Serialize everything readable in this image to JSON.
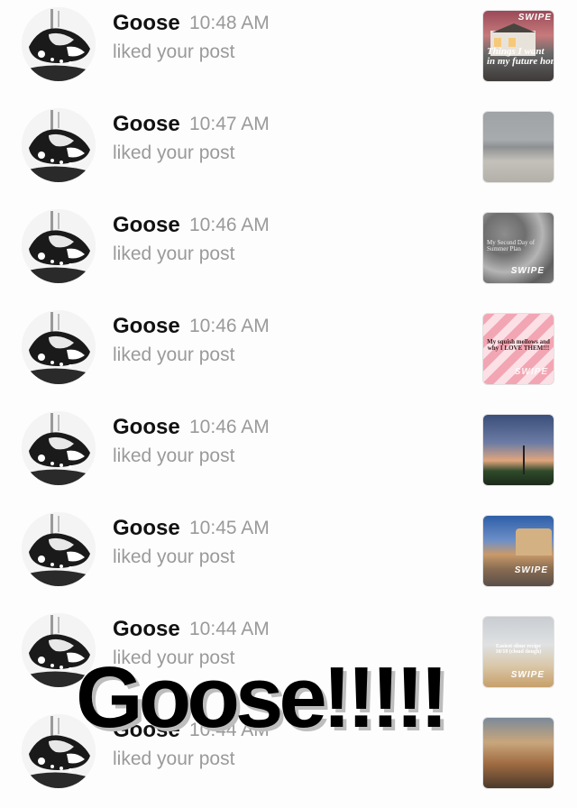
{
  "notifications": [
    {
      "user": "Goose",
      "time": "10:48 AM",
      "action": "liked your post",
      "thumb_caption": "Things I want\nin my future home",
      "thumb_tag": "SWIPE"
    },
    {
      "user": "Goose",
      "time": "10:47 AM",
      "action": "liked your post",
      "thumb_caption": "",
      "thumb_tag": ""
    },
    {
      "user": "Goose",
      "time": "10:46 AM",
      "action": "liked your post",
      "thumb_caption": "My Second Day of\nSummer Plan",
      "thumb_tag": "SWIPE"
    },
    {
      "user": "Goose",
      "time": "10:46 AM",
      "action": "liked your post",
      "thumb_caption": "My squish mellows and\nwhy I LOVE THEM!!!",
      "thumb_tag": "SWIPE"
    },
    {
      "user": "Goose",
      "time": "10:46 AM",
      "action": "liked your post",
      "thumb_caption": "",
      "thumb_tag": ""
    },
    {
      "user": "Goose",
      "time": "10:45 AM",
      "action": "liked your post",
      "thumb_caption": "",
      "thumb_tag": "SWIPE"
    },
    {
      "user": "Goose",
      "time": "10:44 AM",
      "action": "liked your post",
      "thumb_caption": "Easiest slime recipe\n10/10 (cloud dough)",
      "thumb_tag": "SWIPE"
    },
    {
      "user": "Goose",
      "time": "10:44 AM",
      "action": "liked your post",
      "thumb_caption": "",
      "thumb_tag": ""
    }
  ],
  "overlay_text": "Goose!!!!!",
  "colors": {
    "background": "#fdfdfd",
    "name": "#111111",
    "meta": "#9a9a9a"
  }
}
